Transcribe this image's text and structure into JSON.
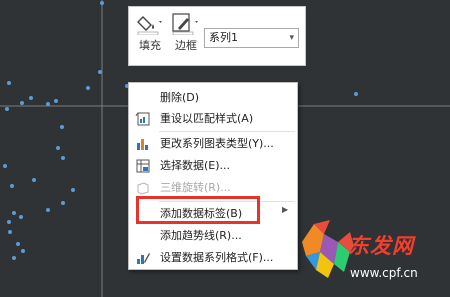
{
  "mini_toolbar": {
    "fill_label": "填充",
    "border_label": "边框",
    "series_value": "系列1"
  },
  "context_menu": {
    "items": [
      {
        "label": "删除(D)",
        "icon": "none",
        "disabled": false
      },
      {
        "label": "重设以匹配样式(A)",
        "icon": "reset-style-icon",
        "disabled": false
      },
      {
        "label": "更改系列图表类型(Y)...",
        "icon": "chart-type-icon",
        "disabled": false
      },
      {
        "label": "选择数据(E)...",
        "icon": "select-data-icon",
        "disabled": false
      },
      {
        "label": "三维旋转(R)...",
        "icon": "rotate-3d-icon",
        "disabled": true
      },
      {
        "label": "添加数据标签(B)",
        "icon": "none",
        "disabled": false,
        "submenu": true
      },
      {
        "label": "添加趋势线(R)...",
        "icon": "none",
        "disabled": false
      },
      {
        "label": "设置数据系列格式(F)...",
        "icon": "format-series-icon",
        "disabled": false
      }
    ]
  },
  "watermark": {
    "brand": "东发网",
    "site": "www.cpf.cn"
  },
  "colors": {
    "background": "#2f3336",
    "highlight_box": "#e8332a",
    "scatter_point": "#5b9bd5"
  }
}
